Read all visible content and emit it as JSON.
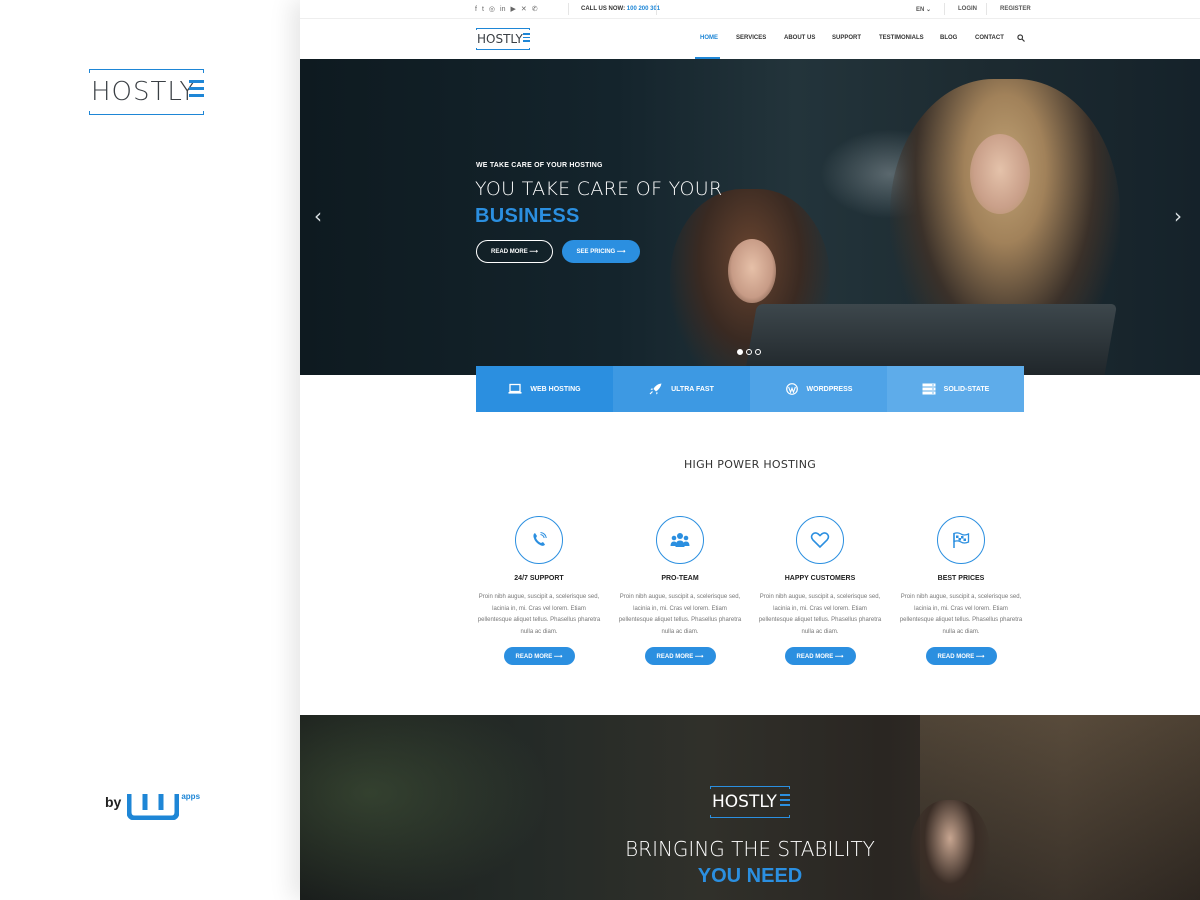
{
  "brand": {
    "logo_text": "HOSTLY",
    "by_label": "by",
    "maker_text": "apps"
  },
  "topbar": {
    "socials": [
      "facebook",
      "twitter",
      "instagram",
      "linkedin",
      "youtube",
      "xing",
      "whatsapp"
    ],
    "call_label": "CALL US NOW:",
    "call_number": "100 200 301",
    "language": "EN",
    "login": "LOGIN",
    "register": "REGISTER"
  },
  "nav": {
    "logo_text": "HOSTLY",
    "items": [
      "HOME",
      "SERVICES",
      "ABOUT US",
      "SUPPORT",
      "TESTIMONIALS",
      "BLOG",
      "CONTACT"
    ],
    "active": "HOME"
  },
  "hero": {
    "kicker": "WE TAKE CARE OF YOUR HOSTING",
    "heading_line1": "YOU TAKE CARE OF YOUR",
    "heading_line2": "BUSINESS",
    "btn_read_more": "READ MORE ⟶",
    "btn_see_pricing": "SEE PRICING ⟶",
    "prev_arrow": "‹",
    "next_arrow": "›",
    "slides_total": 3,
    "slide_active": 1
  },
  "feature_tabs": [
    {
      "label": "WEB HOSTING",
      "icon": "laptop-icon"
    },
    {
      "label": "ULTRA FAST",
      "icon": "rocket-icon"
    },
    {
      "label": "WORDPRESS",
      "icon": "wordpress-icon"
    },
    {
      "label": "SOLID-STATE",
      "icon": "server-icon"
    }
  ],
  "section": {
    "title": "HIGH POWER HOSTING",
    "features": [
      {
        "title": "24/7 SUPPORT",
        "icon": "phone-icon",
        "text": "Proin nibh augue, suscipit a, scelerisque sed, lacinia in, mi. Cras vel lorem. Etiam pellentesque aliquet tellus. Phasellus pharetra nulla ac diam.",
        "button": "READ MORE ⟶"
      },
      {
        "title": "PRO-TEAM",
        "icon": "team-icon",
        "text": "Proin nibh augue, suscipit a, scelerisque sed, lacinia in, mi. Cras vel lorem. Etiam pellentesque aliquet tellus. Phasellus pharetra nulla ac diam.",
        "button": "READ MORE ⟶"
      },
      {
        "title": "HAPPY CUSTOMERS",
        "icon": "heart-icon",
        "text": "Proin nibh augue, suscipit a, scelerisque sed, lacinia in, mi. Cras vel lorem. Etiam pellentesque aliquet tellus. Phasellus pharetra nulla ac diam.",
        "button": "READ MORE ⟶"
      },
      {
        "title": "BEST PRICES",
        "icon": "flag-icon",
        "text": "Proin nibh augue, suscipit a, scelerisque sed, lacinia in, mi. Cras vel lorem. Etiam pellentesque aliquet tellus. Phasellus pharetra nulla ac diam.",
        "button": "READ MORE ⟶"
      }
    ]
  },
  "band": {
    "logo_text": "HOSTLY",
    "line1": "BRINGING THE STABILITY",
    "line2": "YOU NEED"
  },
  "colors": {
    "accent": "#2b8fe0",
    "dark": "#0e1a20"
  }
}
